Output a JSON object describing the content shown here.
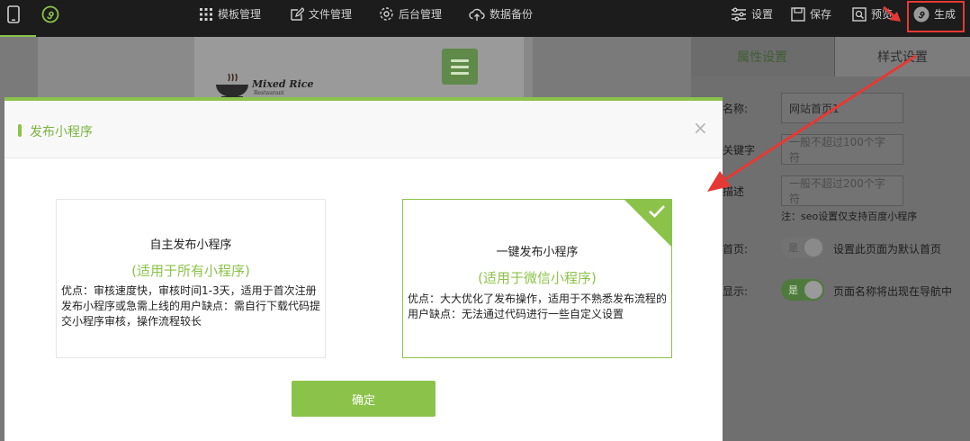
{
  "toolbar": {
    "template": "模板管理",
    "file": "文件管理",
    "backend": "后台管理",
    "backup": "数据备份",
    "settings": "设置",
    "save": "保存",
    "preview": "预览",
    "generate": "生成"
  },
  "canvas": {
    "logo_name": "Mixed Rice",
    "logo_sub": "Restaurant"
  },
  "panel": {
    "tab_attr": "属性设置",
    "tab_style": "样式设置",
    "name_label": "名称:",
    "name_value": "网站首页1",
    "keywords_label": "关键字",
    "keywords_placeholder": "一般不超过100个字符",
    "desc_label": "描述",
    "desc_placeholder": "一般不超过200个字符",
    "seo_note": "注：seo设置仅支持百度小程序",
    "home_label": "首页:",
    "home_toggle": "是",
    "home_hint": "设置此页面为默认首页",
    "show_label": "显示:",
    "show_toggle": "是",
    "show_hint": "页面名称将出现在导航中"
  },
  "modal": {
    "title": "发布小程序",
    "close": "×",
    "option1": {
      "title": "自主发布小程序",
      "subtitle": "(适用于所有小程序)",
      "desc": "优点：审核速度快，审核时间1-3天，适用于首次注册发布小程序或急需上线的用户缺点：需自行下载代码提交小程序审核，操作流程较长"
    },
    "option2": {
      "title": "一键发布小程序",
      "subtitle": "(适用于微信小程序)",
      "desc": "优点：大大优化了发布操作，适用于不熟悉发布流程的用户缺点：无法通过代码进行一些自定义设置"
    },
    "confirm": "确定"
  },
  "colors": {
    "accent": "#8bc34a",
    "annotation": "#e53935"
  }
}
